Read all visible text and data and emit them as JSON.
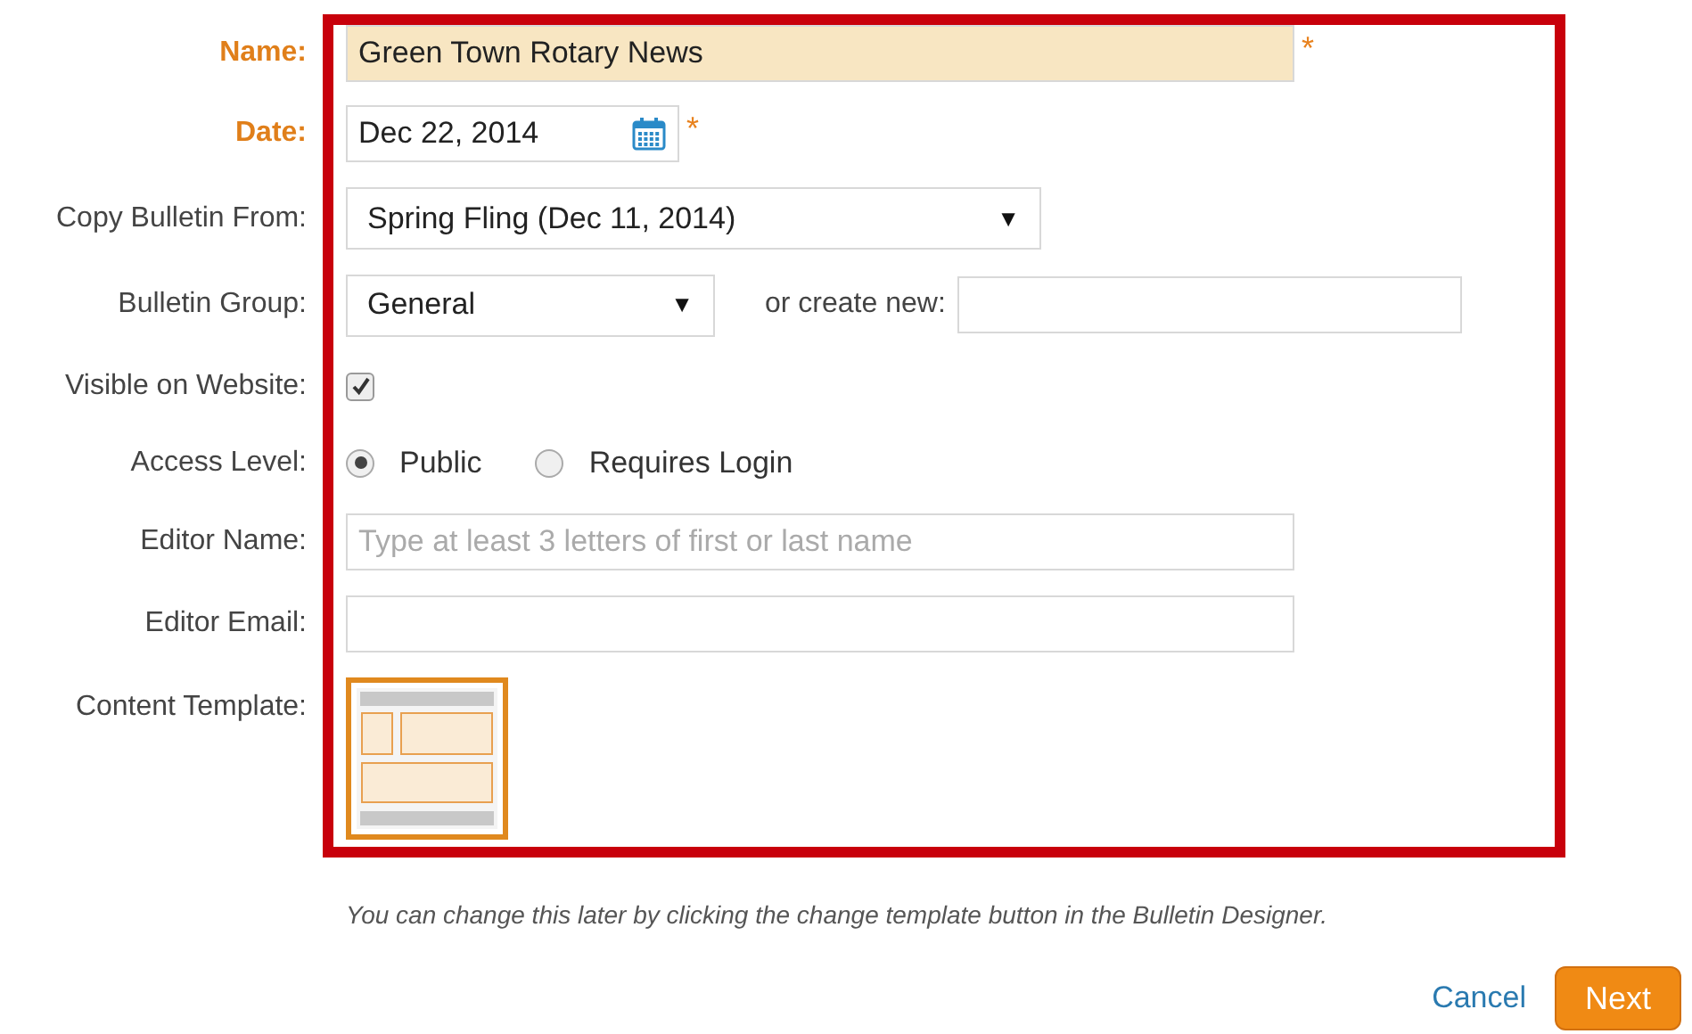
{
  "fields": [
    {
      "kind": "text",
      "label": "Name:",
      "required": true,
      "value": "Green Town Rotary News",
      "highlighted": true
    },
    {
      "kind": "date",
      "label": "Date:",
      "required": true,
      "value": "Dec 22, 2014"
    },
    {
      "kind": "select",
      "label": "Copy Bulletin From:",
      "required": false,
      "value": "Spring Fling (Dec 11, 2014)",
      "caret": "▼"
    },
    {
      "kind": "group",
      "label": "Bulletin Group:",
      "required": false,
      "value": "General",
      "caret": "▼",
      "create_label": "or create new:"
    },
    {
      "kind": "checkbox",
      "label": "Visible on Website:",
      "required": false,
      "checked": true
    },
    {
      "kind": "radio",
      "label": "Access Level:",
      "required": false,
      "options": [
        {
          "label": "Public",
          "selected": true
        },
        {
          "label": "Requires Login",
          "selected": false
        }
      ]
    },
    {
      "kind": "input",
      "label": "Editor Name:",
      "required": false,
      "placeholder": "Type at least 3 letters of first or last name"
    },
    {
      "kind": "input",
      "label": "Editor Email:",
      "required": false
    },
    {
      "kind": "template",
      "label": "Content Template:",
      "required": false,
      "selected": true
    }
  ],
  "required_mark": "*",
  "note": "You can change this later by clicking the change template button in the Bulletin Designer.",
  "buttons": {
    "cancel": "Cancel",
    "next": "Next"
  }
}
